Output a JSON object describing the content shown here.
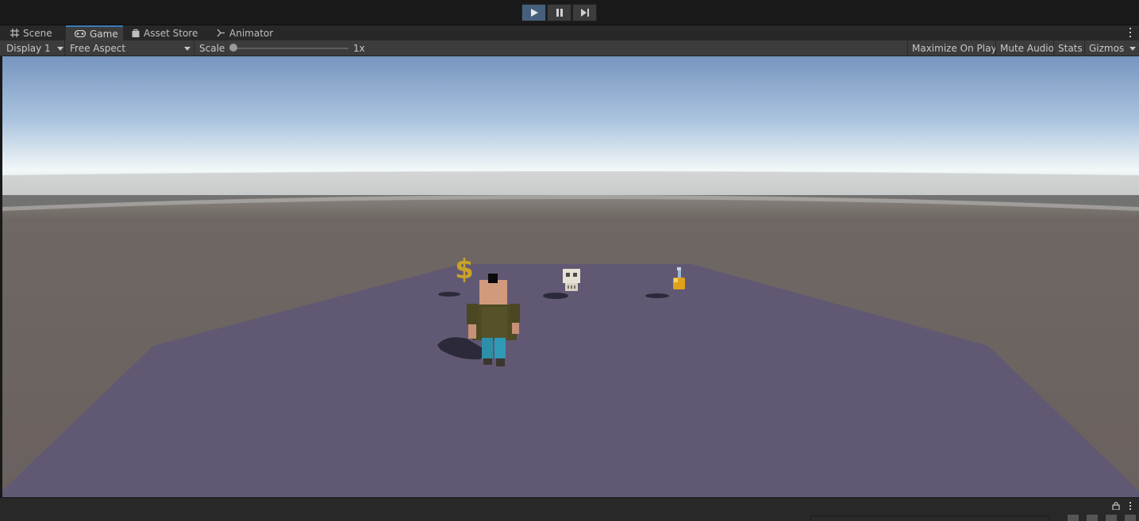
{
  "play_controls": [
    {
      "name": "play-button",
      "icon": "play-icon",
      "active": true
    },
    {
      "name": "pause-button",
      "icon": "pause-icon",
      "active": false
    },
    {
      "name": "step-button",
      "icon": "step-icon",
      "active": false
    }
  ],
  "tabs": [
    {
      "label": "Scene",
      "icon": "grid-icon",
      "selected": false
    },
    {
      "label": "Game",
      "icon": "gamepad-icon",
      "selected": true
    },
    {
      "label": "Asset Store",
      "icon": "bag-icon",
      "selected": false
    },
    {
      "label": "Animator",
      "icon": "animator-icon",
      "selected": false
    }
  ],
  "game_toolbar": {
    "display": "Display 1",
    "aspect": "Free Aspect",
    "scale_label": "Scale",
    "scale_value": "1x",
    "maximize": "Maximize On Play",
    "mute": "Mute Audio",
    "stats": "Stats",
    "gizmos": "Gizmos"
  },
  "scene": {
    "objects": [
      "player-character",
      "dollar-coin",
      "skull",
      "potion-bottle"
    ],
    "colors": {
      "sky_top": "#7795c0",
      "horizon": "#f2f7f8",
      "ground": "#6a615f",
      "plane": "#615874",
      "accent": "#3a79bb"
    }
  }
}
